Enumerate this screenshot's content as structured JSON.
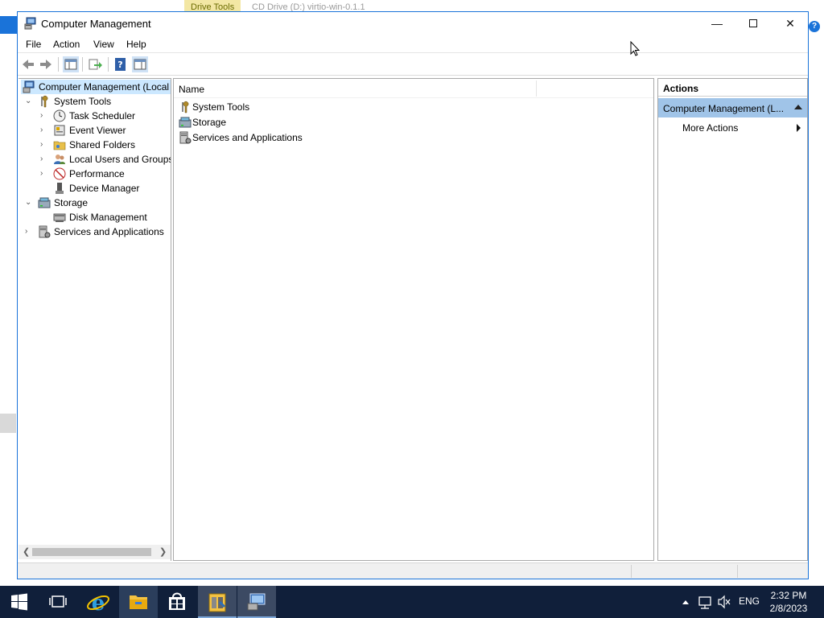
{
  "background": {
    "drive_tools": "Drive Tools",
    "title": "CD Drive (D:) virtio-win-0.1.1"
  },
  "window": {
    "title": "Computer Management",
    "minimize": "—",
    "close": "✕"
  },
  "menu": [
    "File",
    "Action",
    "View",
    "Help"
  ],
  "tree": {
    "root": "Computer Management (Local",
    "system_tools": "System Tools",
    "task_scheduler": "Task Scheduler",
    "event_viewer": "Event Viewer",
    "shared_folders": "Shared Folders",
    "local_users": "Local Users and Groups",
    "performance": "Performance",
    "device_manager": "Device Manager",
    "storage": "Storage",
    "disk_management": "Disk Management",
    "services_apps": "Services and Applications"
  },
  "content": {
    "column_name": "Name",
    "items": [
      "System Tools",
      "Storage",
      "Services and Applications"
    ]
  },
  "actions": {
    "header": "Actions",
    "section": "Computer Management (L...",
    "more_actions": "More Actions"
  },
  "taskbar": {
    "language": "ENG",
    "time": "2:32 PM",
    "date": "2/8/2023"
  },
  "colors": {
    "accent": "#1a73d9",
    "selection": "#cce8ff",
    "actions_section": "#a0c4e8",
    "taskbar": "#101f3a"
  }
}
